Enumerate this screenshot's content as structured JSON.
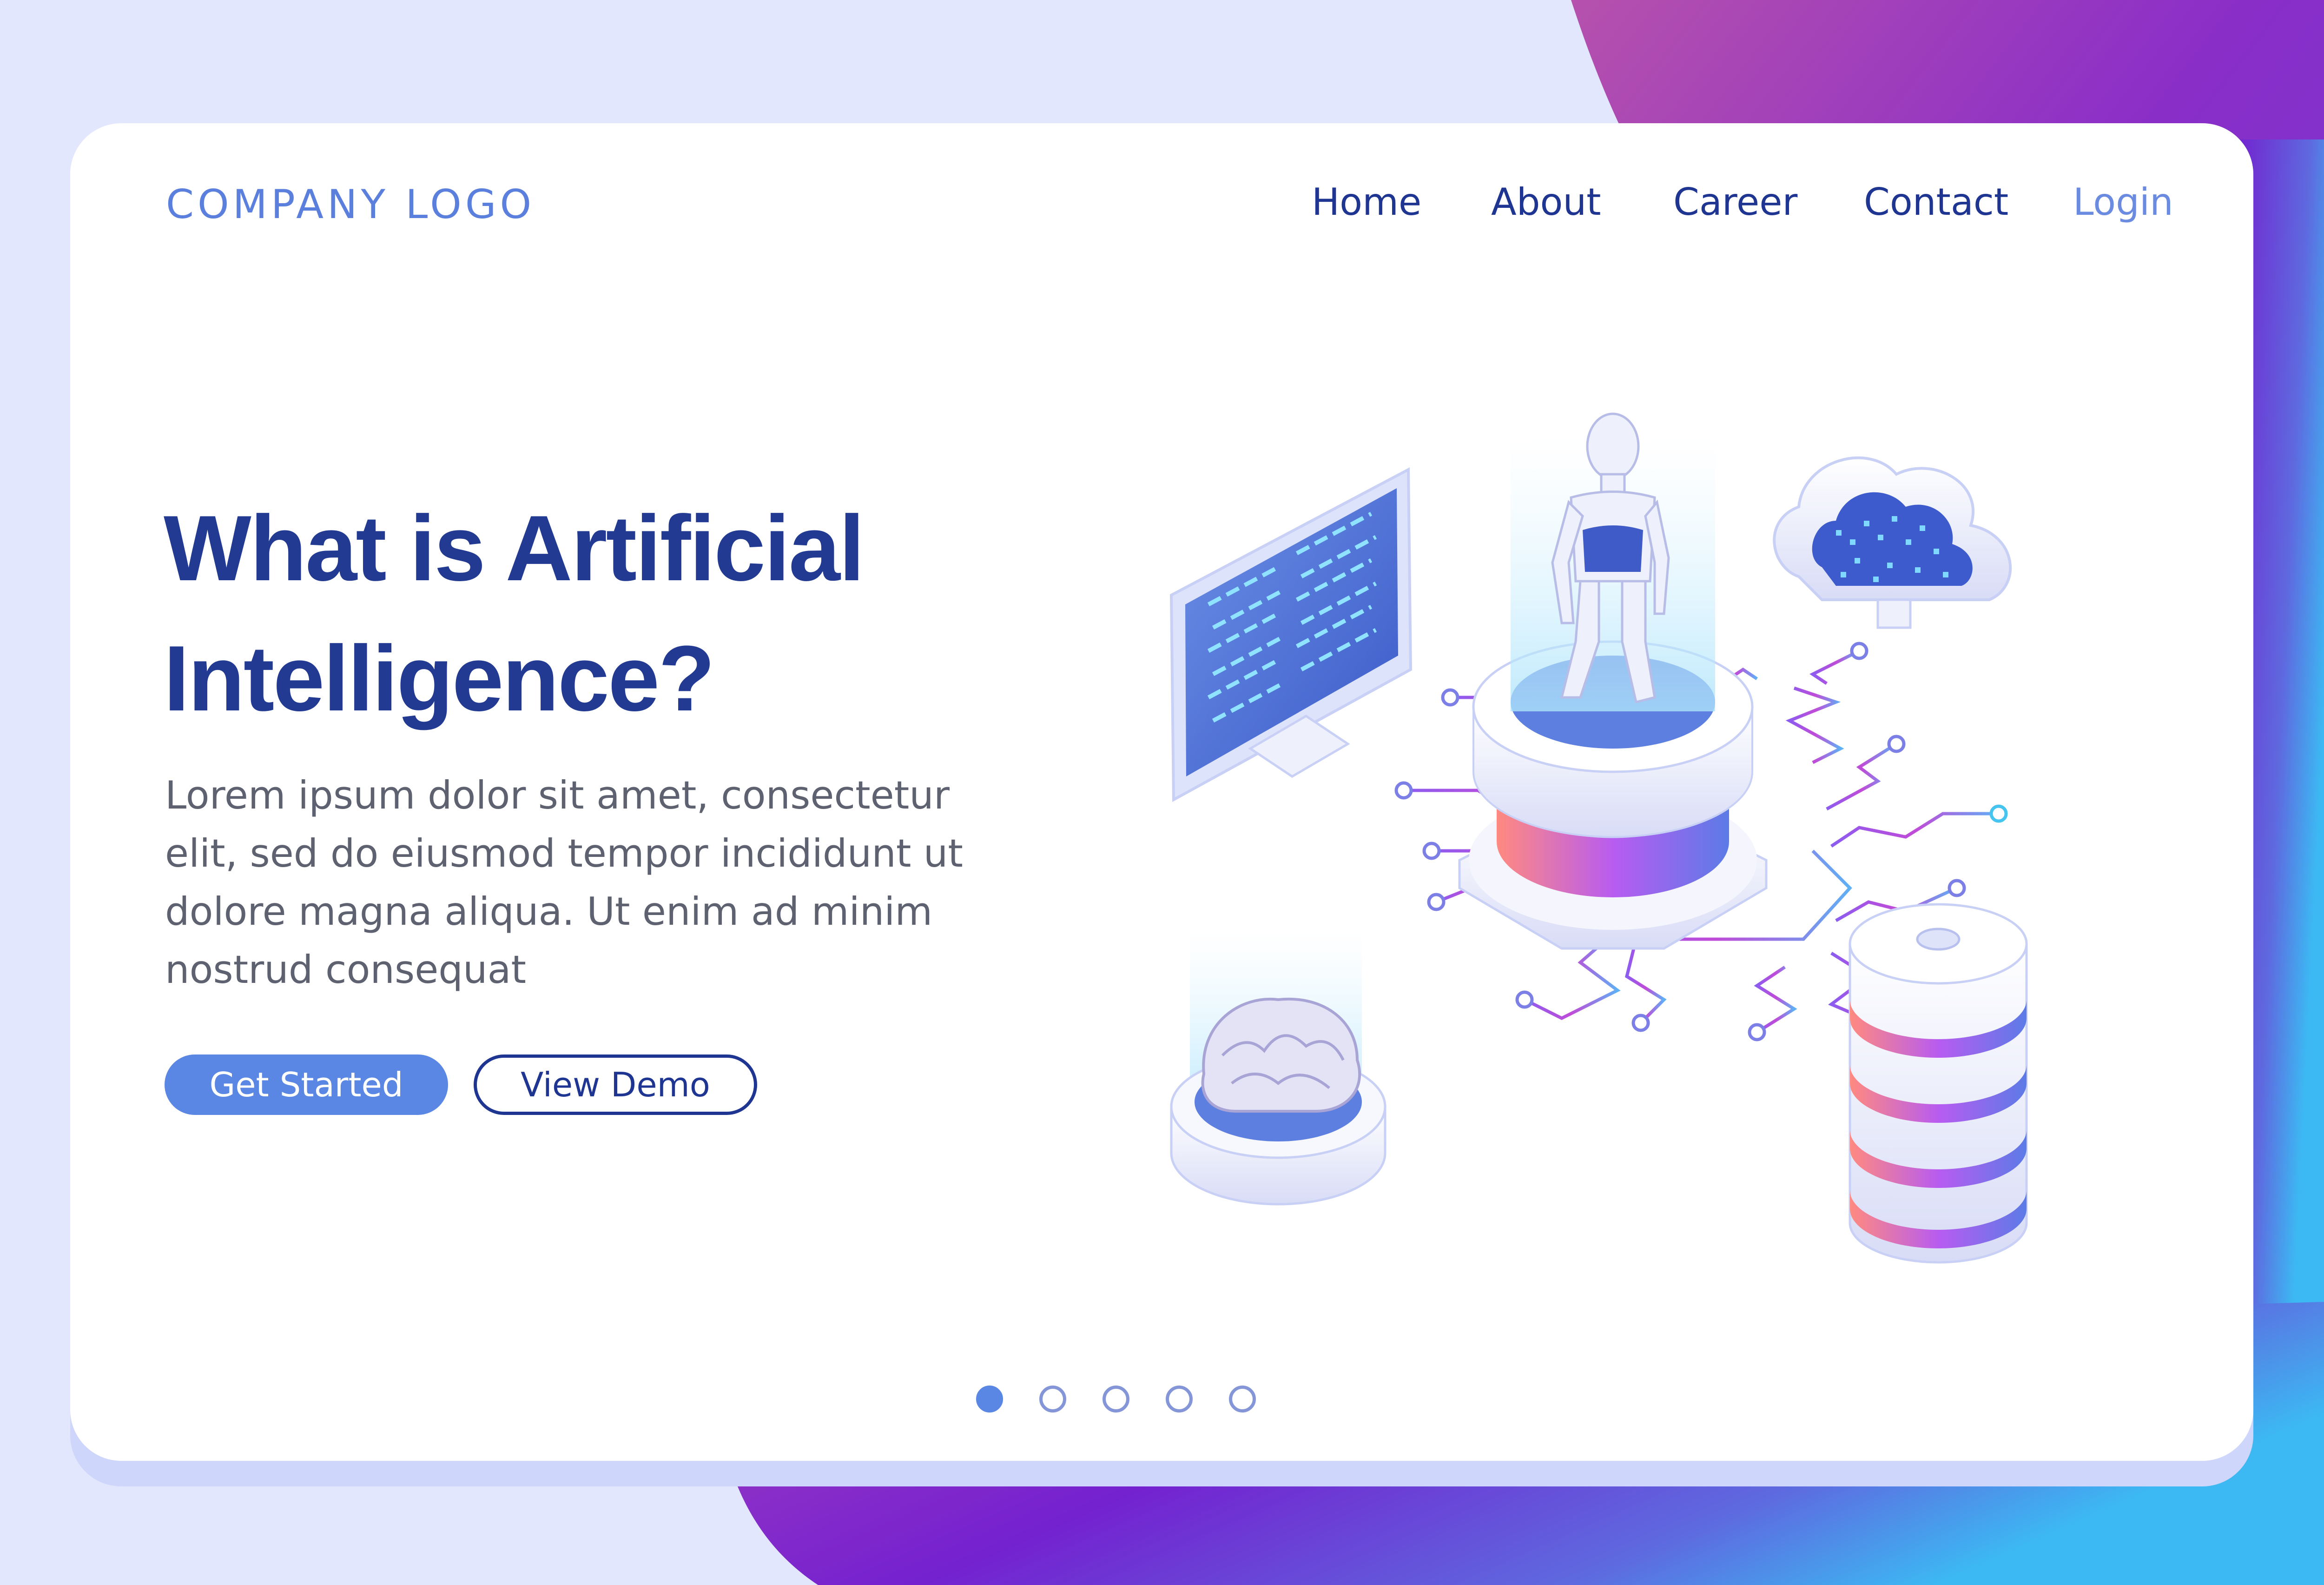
{
  "colors": {
    "background": "#e3e7fd",
    "card": "#ffffff",
    "accent": "#5a86e4",
    "heading": "#223a92",
    "nav_text": "#1f3592",
    "body_text": "#5d6170",
    "gradient_start": "#9a3bc4",
    "gradient_mid": "#7a27d0",
    "gradient_end": "#3db6f2"
  },
  "header": {
    "logo": "COMPANY LOGO",
    "nav": [
      "Home",
      "About",
      "Career",
      "Contact"
    ],
    "login": "Login"
  },
  "hero": {
    "title_line1": "What is Artificial",
    "title_line2": "Intelligence?",
    "body": "Lorem ipsum dolor sit amet, consectetur elit, sed do eiusmod tempor incididunt ut dolore magna aliqua. Ut enim ad minim nostrud consequat",
    "primary_button": "Get Started",
    "secondary_button": "View Demo"
  },
  "carousel": {
    "total": 5,
    "active": 1
  },
  "illustration": {
    "icons": [
      "monitor-icon",
      "robot-icon",
      "cloud-icon",
      "brain-icon",
      "database-icon",
      "circuit-icon"
    ]
  }
}
